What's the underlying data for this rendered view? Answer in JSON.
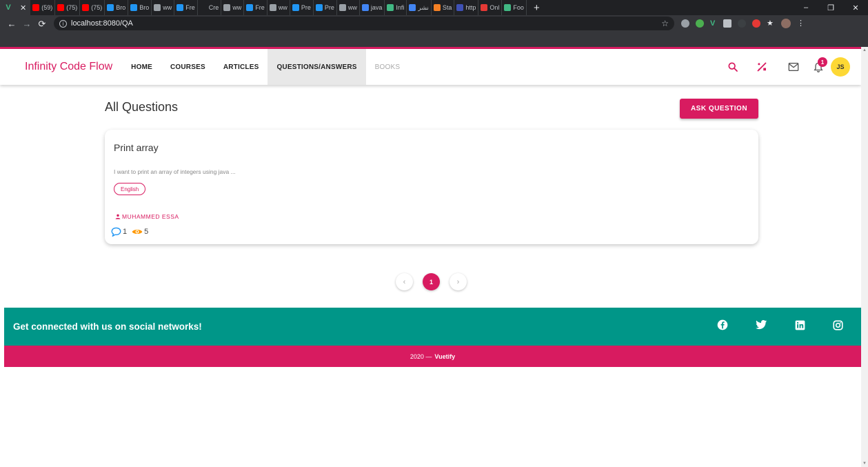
{
  "browser": {
    "active_tab_title": "V",
    "tabs": [
      "(59)",
      "(75)",
      "(75)",
      "Bro",
      "Bro",
      "ww",
      "Fre",
      "Cre",
      "ww",
      "Fre",
      "ww",
      "Pre",
      "Pre",
      "ww",
      "java",
      "Infi",
      "نشر",
      "Sta",
      "http",
      "Onl",
      "Foo"
    ],
    "url": "localhost:8080/QA",
    "win_minimize": "–",
    "win_restore": "❐",
    "win_close": "✕",
    "new_tab": "+",
    "colors": {
      "chrome_dark": "#202124",
      "chrome_mid": "#35363a"
    }
  },
  "header": {
    "brand": "Infinity Code Flow",
    "nav": [
      {
        "label": "HOME",
        "state": "normal"
      },
      {
        "label": "COURSES",
        "state": "normal"
      },
      {
        "label": "ARTICLES",
        "state": "normal"
      },
      {
        "label": "QUESTIONS/ANSWERS",
        "state": "active"
      },
      {
        "label": "BOOKS",
        "state": "disabled"
      }
    ],
    "icons": [
      "search-icon",
      "tools-icon",
      "mail-icon",
      "bell-icon"
    ],
    "notification_count": "1",
    "avatar_initials": "JS"
  },
  "main": {
    "title": "All Questions",
    "ask_button": "ASK QUESTION",
    "questions": [
      {
        "title": "Print array",
        "body": "I want to print an array of integers using java ...",
        "tag": "English",
        "author": "MUHAMMED ESSA",
        "comments": "1",
        "views": "5"
      }
    ]
  },
  "pagination": {
    "prev": "‹",
    "current": "1",
    "next": "›"
  },
  "footer": {
    "social_text": "Get connected with us on social networks!",
    "social_icons": [
      "facebook-icon",
      "twitter-icon",
      "linkedin-icon",
      "instagram-icon"
    ],
    "year": "2020 —",
    "credit": "Vuetify"
  },
  "colors": {
    "primary": "#d81b60",
    "teal": "#009688",
    "avatar": "#fdd835",
    "views_icon": "#ff9800",
    "comments_icon": "#2196f3"
  }
}
